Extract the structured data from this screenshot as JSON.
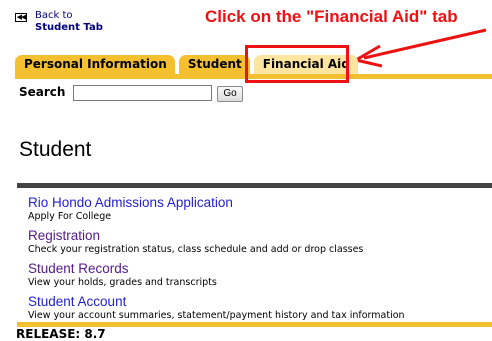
{
  "back": {
    "icon": "rewind-icon",
    "line1": "Back to",
    "line2": "Student Tab"
  },
  "annotation": {
    "text": "Click on the \"Financial Aid\" tab",
    "color": "#ee1111"
  },
  "tabs": [
    {
      "label": "Personal Information",
      "active": false
    },
    {
      "label": "Student",
      "active": false
    },
    {
      "label": "Financial Aid",
      "active": true
    }
  ],
  "search": {
    "label": "Search",
    "value": "",
    "button": "Go"
  },
  "page_title": "Student",
  "menu": [
    {
      "title": "Rio Hondo Admissions Application",
      "desc": "Apply For College",
      "color": "#2222cc"
    },
    {
      "title": "Registration",
      "desc": "Check your registration status, class schedule and add or drop classes",
      "color": "#551a8b"
    },
    {
      "title": "Student Records",
      "desc": "View your holds, grades and transcripts",
      "color": "#551a8b"
    },
    {
      "title": "Student Account",
      "desc": "View your account summaries, statement/payment history and tax information",
      "color": "#2222cc"
    }
  ],
  "release": "RELEASE: 8.7",
  "colors": {
    "tab": "#f5c030",
    "tab_active": "#fce5a0",
    "link": "#2222cc",
    "visited": "#551a8b"
  }
}
